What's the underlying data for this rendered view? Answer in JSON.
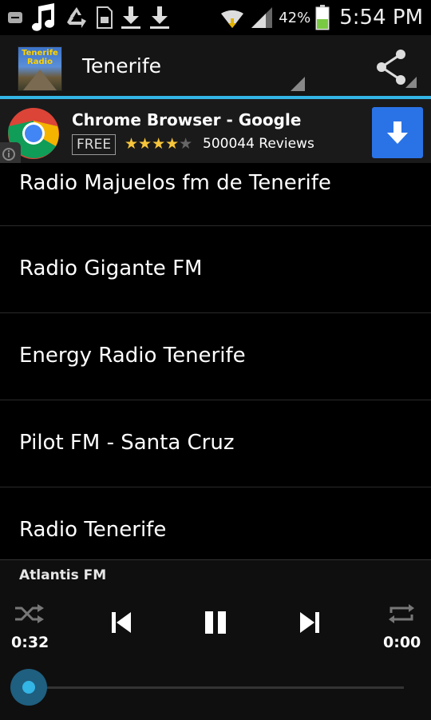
{
  "status_bar": {
    "icons": [
      "notification-icon",
      "music-note-icon",
      "recycle-icon",
      "sim-icon",
      "download-icon",
      "download-icon",
      "wifi-icon",
      "signal-icon"
    ],
    "battery_percent": "42%",
    "time": "5:54 PM"
  },
  "action_bar": {
    "app_logo_text": "Tenerife Radio",
    "title": "Tenerife"
  },
  "ad": {
    "title": "Chrome Browser - Google",
    "badge": "FREE",
    "stars_filled": "★★★★",
    "stars_empty": "★",
    "reviews": "500044 Reviews"
  },
  "stations": [
    {
      "label": "Radio Majuelos fm de Tenerife"
    },
    {
      "label": "Radio Gigante FM"
    },
    {
      "label": "Energy Radio Tenerife"
    },
    {
      "label": "Pilot FM - Santa Cruz"
    },
    {
      "label": "Radio Tenerife"
    }
  ],
  "player": {
    "now_playing": "Atlantis FM",
    "elapsed": "0:32",
    "duration": "0:00",
    "progress": 0
  },
  "colors": {
    "accent": "#33b5e5",
    "background": "#000000",
    "ad_download": "#2a73e6",
    "star": "#f6c53b"
  }
}
